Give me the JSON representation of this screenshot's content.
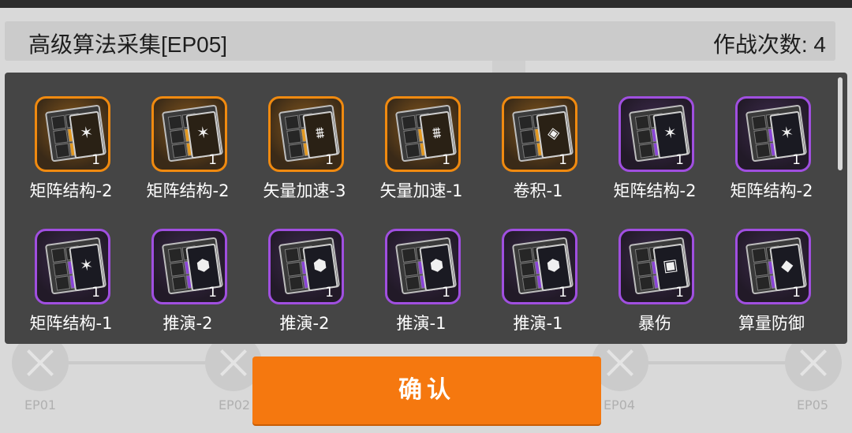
{
  "header": {
    "title": "高级算法采集[EP05]",
    "battle_count": "作战次数: 4"
  },
  "rewards": [
    {
      "name": "矩阵结构-2",
      "qty": "1",
      "rarity": "orange",
      "icon": "matrix-icon"
    },
    {
      "name": "矩阵结构-2",
      "qty": "1",
      "rarity": "orange",
      "icon": "matrix-icon"
    },
    {
      "name": "矢量加速-3",
      "qty": "1",
      "rarity": "orange",
      "icon": "vector-icon"
    },
    {
      "name": "矢量加速-1",
      "qty": "1",
      "rarity": "orange",
      "icon": "vector-icon"
    },
    {
      "name": "卷积-1",
      "qty": "1",
      "rarity": "orange",
      "icon": "convolution-icon"
    },
    {
      "name": "矩阵结构-2",
      "qty": "1",
      "rarity": "purple",
      "icon": "matrix-icon"
    },
    {
      "name": "矩阵结构-2",
      "qty": "1",
      "rarity": "purple",
      "icon": "matrix-icon"
    },
    {
      "name": "矩阵结构-1",
      "qty": "1",
      "rarity": "purple",
      "icon": "matrix-icon"
    },
    {
      "name": "推演-2",
      "qty": "1",
      "rarity": "purple",
      "icon": "deduction-icon"
    },
    {
      "name": "推演-2",
      "qty": "1",
      "rarity": "purple",
      "icon": "deduction-icon"
    },
    {
      "name": "推演-1",
      "qty": "1",
      "rarity": "purple",
      "icon": "deduction-icon"
    },
    {
      "name": "推演-1",
      "qty": "1",
      "rarity": "purple",
      "icon": "deduction-icon"
    },
    {
      "name": "暴伤",
      "qty": "1",
      "rarity": "purple",
      "icon": "crit-damage-icon"
    },
    {
      "name": "算量防御",
      "qty": "1",
      "rarity": "purple",
      "icon": "defense-icon"
    }
  ],
  "confirm_label": "确认",
  "background": {
    "nodes": [
      "EP01",
      "EP02",
      "EP04",
      "EP05"
    ]
  },
  "colors": {
    "orange_rarity": "#f08a10",
    "purple_rarity": "#a04fe0",
    "confirm_button": "#f5780f",
    "panel": "#454545"
  }
}
